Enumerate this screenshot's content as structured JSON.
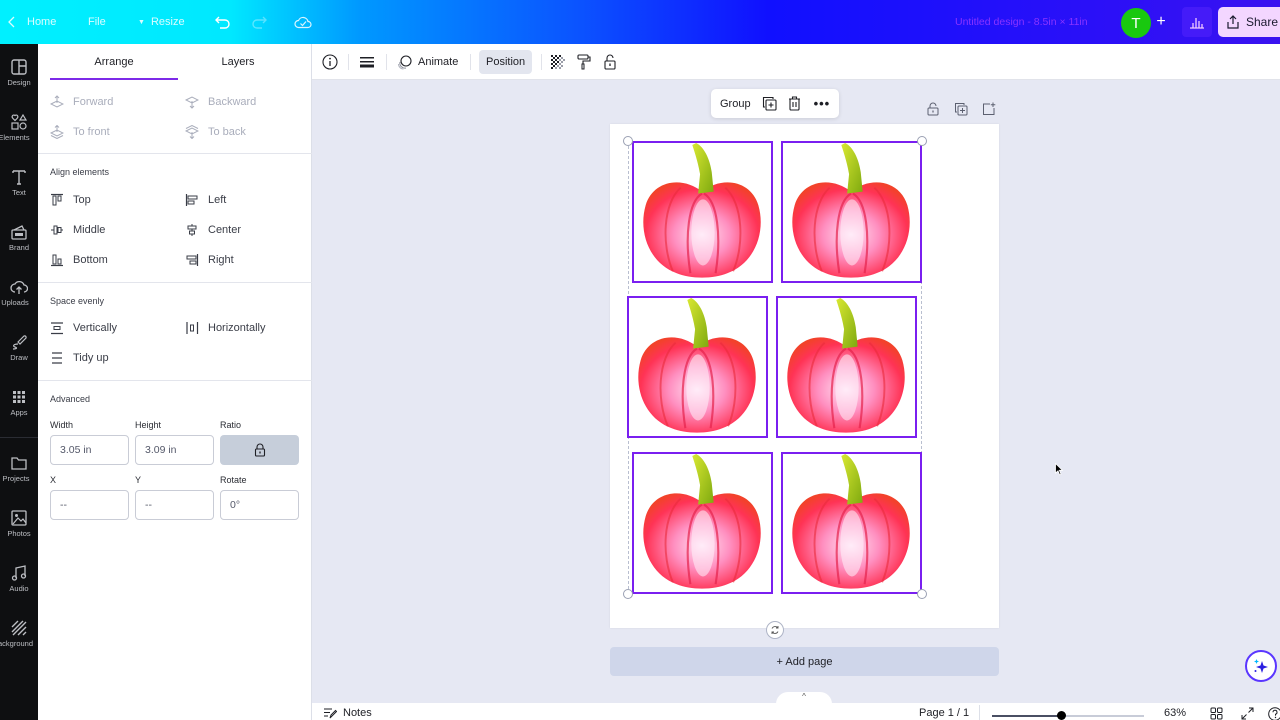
{
  "topbar": {
    "home_label": "Home",
    "file_label": "File",
    "resize_label": "Resize",
    "doc_title": "Untitled design - 8.5in × 11in",
    "avatar_initial": "T",
    "share_label": "Share",
    "colors": {
      "gradient_start": "#00f0ff",
      "gradient_end": "#3a12f0",
      "avatar": "#19c80f",
      "share_bg": "#f3d6ff"
    }
  },
  "rail": {
    "items": [
      {
        "label": "Design",
        "icon": "layout-icon"
      },
      {
        "label": "Elements",
        "icon": "shapes-icon"
      },
      {
        "label": "Text",
        "icon": "text-icon"
      },
      {
        "label": "Brand",
        "icon": "brand-icon"
      },
      {
        "label": "Uploads",
        "icon": "upload-cloud-icon"
      },
      {
        "label": "Draw",
        "icon": "draw-icon"
      },
      {
        "label": "Apps",
        "icon": "apps-grid-icon"
      },
      {
        "label": "Projects",
        "icon": "folder-icon"
      },
      {
        "label": "Photos",
        "icon": "photo-icon"
      },
      {
        "label": "Audio",
        "icon": "music-note-icon"
      },
      {
        "label": "Background",
        "icon": "hatch-icon"
      }
    ]
  },
  "panel": {
    "tabs": [
      {
        "label": "Arrange",
        "active": true
      },
      {
        "label": "Layers",
        "active": false
      }
    ],
    "layer_order": {
      "forward": "Forward",
      "backward": "Backward",
      "to_front": "To front",
      "to_back": "To back"
    },
    "align": {
      "title": "Align elements",
      "top": "Top",
      "left": "Left",
      "middle": "Middle",
      "center": "Center",
      "bottom": "Bottom",
      "right": "Right"
    },
    "space": {
      "title": "Space evenly",
      "vertically": "Vertically",
      "horizontally": "Horizontally",
      "tidy_up": "Tidy up"
    },
    "advanced": {
      "title": "Advanced",
      "width_label": "Width",
      "width_value": "3.05 in",
      "height_label": "Height",
      "height_value": "3.09 in",
      "ratio_label": "Ratio",
      "ratio_locked": true,
      "x_label": "X",
      "x_value": "--",
      "y_label": "Y",
      "y_value": "--",
      "rotate_label": "Rotate",
      "rotate_value": "0°"
    },
    "accent_color": "#7d2ae8"
  },
  "toolbar": {
    "animate_label": "Animate",
    "position_label": "Position"
  },
  "canvas": {
    "float_bar": {
      "group_label": "Group"
    },
    "add_page_label": "+ Add page",
    "images": [
      {
        "name": "pumpkin-1"
      },
      {
        "name": "pumpkin-2"
      },
      {
        "name": "pumpkin-3"
      },
      {
        "name": "pumpkin-4"
      },
      {
        "name": "pumpkin-5"
      },
      {
        "name": "pumpkin-6"
      }
    ],
    "selection_color": "#7a1ff0"
  },
  "bottombar": {
    "notes_label": "Notes",
    "page_indicator": "Page 1 / 1",
    "zoom_percent": "63%",
    "zoom_fraction": 0.46
  }
}
